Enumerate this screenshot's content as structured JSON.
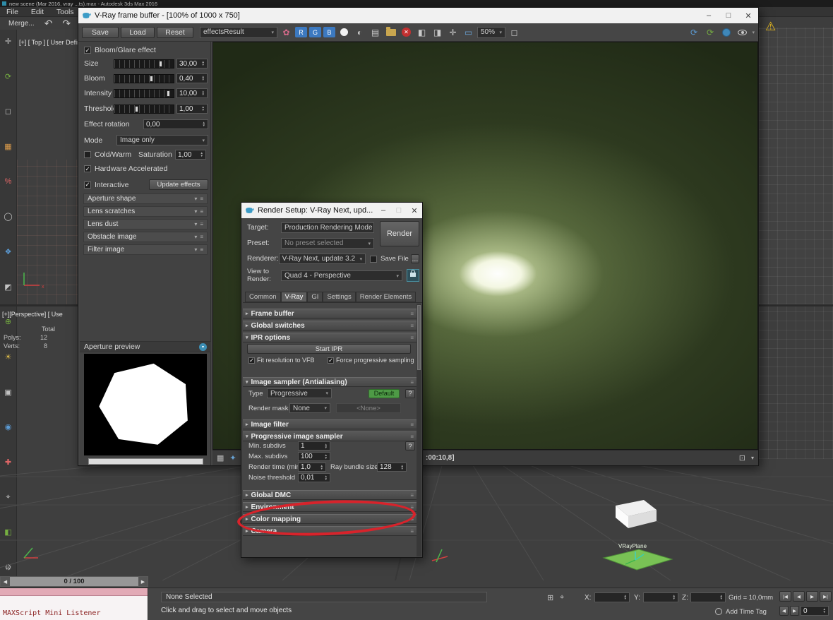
{
  "app": {
    "window_title": "new scene (Mar 2016, vray ...ts).max - Autodesk 3ds Max 2016",
    "menu": [
      "File",
      "Edit",
      "Tools"
    ],
    "merge": "Merge..."
  },
  "icons": {
    "lt": [
      "✛",
      "⟳",
      "◻",
      "▦",
      "%",
      "◯",
      "❖",
      "◩",
      "⊕",
      "☀",
      "▣",
      "◉",
      "✚",
      "⌖",
      "◧",
      "⚙"
    ],
    "undo": "↶",
    "redo": "↷",
    "warning": "⚠",
    "minimize": "–",
    "maximize": "□",
    "close": "✕",
    "flower": "✿",
    "mono": "◐",
    "save_img": "▤",
    "clear": "✕",
    "ab_h": "◧",
    "ab_v": "◨",
    "pan": "✛",
    "monitor": "▭",
    "region": "◻",
    "refresh": "⟳",
    "chev": "▾",
    "menu": "≡",
    "small1": "▦",
    "small2": "✦",
    "frame_box": "⊡",
    "pb": [
      "|◀",
      "◀",
      "▶",
      "▶|"
    ],
    "left": "◀",
    "right": "▶",
    "sel1": "⊞",
    "sel2": "⌖"
  },
  "viewports": {
    "top_label": "[+] [ Top ] [ User Defin",
    "persp_label": "[+][Perspective] [ Use",
    "total_label": "Total",
    "polys_label": "Polys:",
    "polys_value": "12",
    "verts_label": "Verts:",
    "verts_value": "8",
    "plane_label": "VRayPlane"
  },
  "vfb": {
    "title": "V-Ray frame buffer - [100% of 1000 x 750]",
    "save": "Save",
    "load": "Load",
    "reset": "Reset",
    "channel_combo": "effectsResult",
    "channels": [
      "R",
      "G",
      "B"
    ],
    "zoom": "50%",
    "timecode": ":00:10,8]",
    "panel": {
      "bloom_glare": "Bloom/Glare effect",
      "sliders": [
        {
          "label": "Size",
          "value": "30,00"
        },
        {
          "label": "Bloom",
          "value": "0,40"
        },
        {
          "label": "Intensity",
          "value": "10,00"
        },
        {
          "label": "Threshold",
          "value": "1,00"
        }
      ],
      "effect_rotation": "Effect rotation",
      "effect_rotation_value": "0,00",
      "mode": "Mode",
      "mode_value": "Image only",
      "cold_warm": "Cold/Warm",
      "saturation": "Saturation",
      "saturation_value": "1,00",
      "hardware": "Hardware Accelerated",
      "interactive": "Interactive",
      "update_effects": "Update effects",
      "sections": [
        "Aperture shape",
        "Lens scratches",
        "Lens dust",
        "Obstacle image",
        "Filter image"
      ],
      "aperture_preview": "Aperture preview"
    }
  },
  "render_setup": {
    "title": "Render Setup: V-Ray Next, upd...",
    "target_label": "Target:",
    "target_value": "Production Rendering Mode",
    "preset_label": "Preset:",
    "preset_value": "No preset selected",
    "renderer_label": "Renderer:",
    "renderer_value": "V-Ray Next, update 3.2",
    "save_file": "Save File",
    "browse": "...",
    "view_label": "View to Render:",
    "view_value": "Quad 4 - Perspective",
    "render_button": "Render",
    "tabs": [
      "Common",
      "V-Ray",
      "GI",
      "Settings",
      "Render Elements"
    ],
    "rollouts": {
      "frame_buffer": "Frame buffer",
      "global_switches": "Global switches",
      "ipr": "IPR options",
      "sampler": "Image sampler (Antialiasing)",
      "image_filter": "Image filter",
      "progressive": "Progressive image sampler",
      "global_dmc": "Global DMC",
      "environment": "Environment",
      "color_mapping": "Color mapping",
      "camera": "Camera"
    },
    "ipr": {
      "start": "Start IPR",
      "fit": "Fit resolution to VFB",
      "force": "Force progressive sampling"
    },
    "sampler": {
      "type_label": "Type",
      "type_value": "Progressive",
      "default": "Default",
      "help": "?",
      "mask_label": "Render mask",
      "mask_value": "None",
      "mask_btn": "<None>"
    },
    "progressive": {
      "min_label": "Min. subdivs",
      "min": "1",
      "max_label": "Max. subdivs",
      "max": "100",
      "time_label": "Render time (min)",
      "time": "1,0",
      "bundle_label": "Ray bundle size",
      "bundle": "128",
      "noise_label": "Noise threshold",
      "noise": "0,01",
      "help": "?"
    }
  },
  "status": {
    "track": "0 / 100",
    "maxscript": "MAXScript Mini Listener",
    "selected": "None Selected",
    "hint": "Click and drag to select and move objects",
    "x": "X:",
    "y": "Y:",
    "z": "Z:",
    "grid": "Grid = 10,0mm",
    "add_time_tag": "Add Time Tag",
    "frame": "0"
  }
}
